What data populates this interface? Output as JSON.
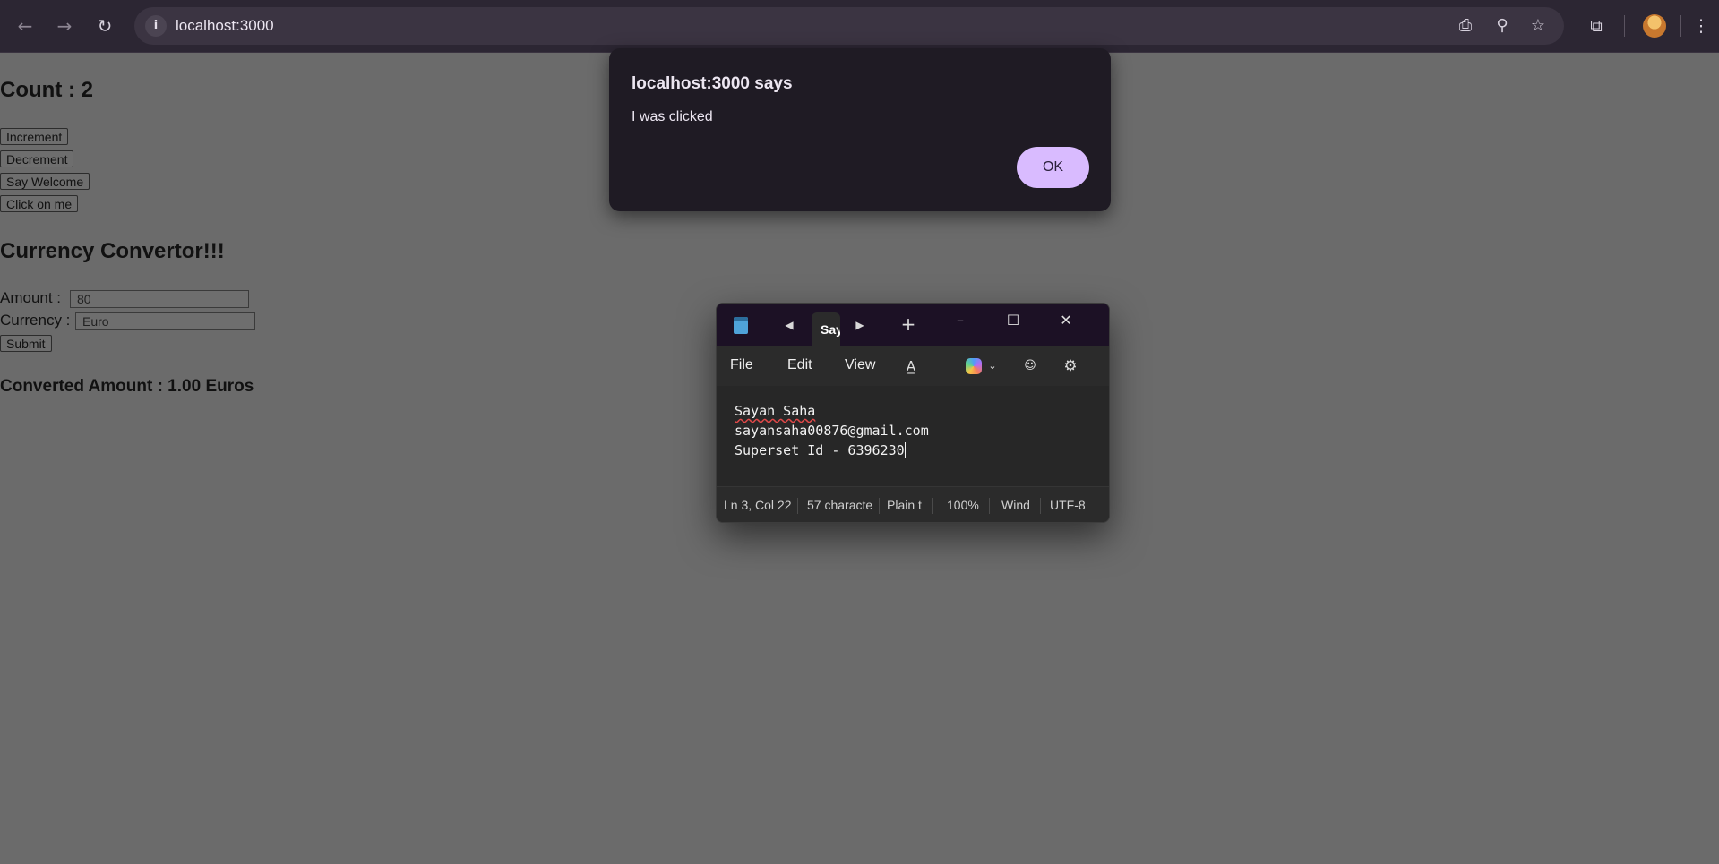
{
  "browser": {
    "url": "localhost:3000",
    "icons": {
      "back": "arrow-left-icon",
      "forward": "arrow-right-icon",
      "reload": "reload-icon",
      "site_info": "info-icon",
      "install": "install-app-icon",
      "zoom": "zoom-icon",
      "bookmark": "star-icon",
      "extensions": "puzzle-icon",
      "menu": "more-vert-icon"
    }
  },
  "page": {
    "count_title": "Count : 2",
    "buttons": {
      "increment": "Increment",
      "decrement": "Decrement",
      "say_welcome": "Say Welcome",
      "click_on_me": "Click on me"
    },
    "currency_title": "Currency Convertor!!!",
    "amount_label": "Amount :",
    "amount_value": "80",
    "currency_label": "Currency :",
    "currency_value": "Euro",
    "submit_label": "Submit",
    "converted_text": "Converted Amount : 1.00 Euros"
  },
  "dialog": {
    "title": "localhost:3000 says",
    "message": "I was clicked",
    "ok_label": "OK"
  },
  "notepad": {
    "tab_label": "Sayan Saha",
    "menu": {
      "file": "File",
      "edit": "Edit",
      "view": "View"
    },
    "lines": [
      "Sayan Saha",
      "sayansaha00876@gmail.com",
      "Superset Id - 6396230"
    ],
    "status": {
      "position": "Ln 3, Col 22",
      "characters": "57 characte",
      "format": "Plain t",
      "zoom": "100%",
      "line_ending": "Wind",
      "encoding": "UTF-8"
    }
  },
  "colors": {
    "dialog_bg": "#1f1b24",
    "ok_button": "#d9bbff",
    "page_dimmed_bg": "#6b6b6b",
    "chrome_bg": "#2c2633"
  }
}
